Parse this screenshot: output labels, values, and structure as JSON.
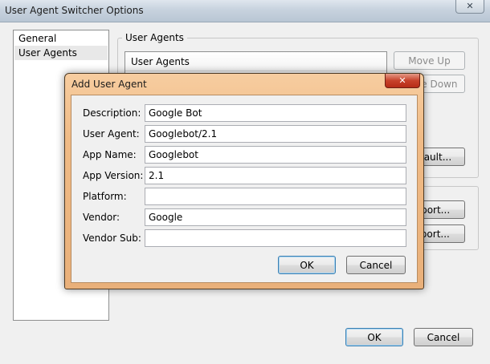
{
  "main_window": {
    "title": "User Agent Switcher Options",
    "close_glyph": "✕",
    "nav": [
      {
        "label": "General"
      },
      {
        "label": "User Agents"
      }
    ],
    "group_legend": "User Agents",
    "list_header": "User Agents",
    "buttons": {
      "move_up": "Move Up",
      "move_down": "Move Down",
      "default": "Default...",
      "import": "Import...",
      "export": "Export...",
      "ok": "OK",
      "cancel": "Cancel"
    }
  },
  "dialog": {
    "title": "Add User Agent",
    "close_glyph": "✕",
    "fields": [
      {
        "label": "Description:",
        "value": "Google Bot"
      },
      {
        "label": "User Agent:",
        "value": "Googlebot/2.1"
      },
      {
        "label": "App Name:",
        "value": "Googlebot"
      },
      {
        "label": "App Version:",
        "value": "2.1"
      },
      {
        "label": "Platform:",
        "value": ""
      },
      {
        "label": "Vendor:",
        "value": "Google"
      },
      {
        "label": "Vendor Sub:",
        "value": ""
      }
    ],
    "buttons": {
      "ok": "OK",
      "cancel": "Cancel"
    }
  }
}
